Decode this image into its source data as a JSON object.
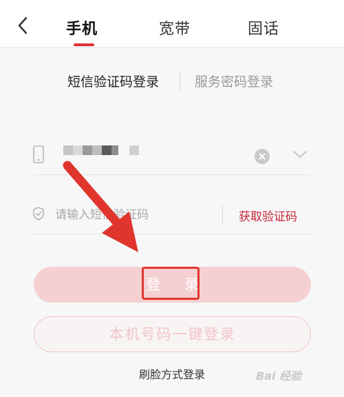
{
  "header": {
    "back_icon": "chevron-left-icon",
    "tabs": [
      {
        "label": "手机",
        "active": true
      },
      {
        "label": "宽带",
        "active": false
      },
      {
        "label": "固话",
        "active": false
      }
    ],
    "accent_color": "#e2303a"
  },
  "login_modes": {
    "sms_label": "短信验证码登录",
    "password_label": "服务密码登录"
  },
  "phone_field": {
    "icon": "phone-icon",
    "clear_icon": "clear-circle-icon",
    "dropdown_icon": "chevron-down-icon"
  },
  "code_field": {
    "icon": "shield-icon",
    "placeholder": "请输入短信验证码",
    "get_code_label": "获取验证码",
    "get_code_color": "#c8243a"
  },
  "buttons": {
    "login_label": "登 录",
    "onekey_label": "本机号码一键登录",
    "face_login_label": "刷脸方式登录"
  },
  "annotation": {
    "arrow_color": "#e0352d",
    "box_color": "#e0352d"
  },
  "watermark": {
    "text": "Bai 经验"
  }
}
